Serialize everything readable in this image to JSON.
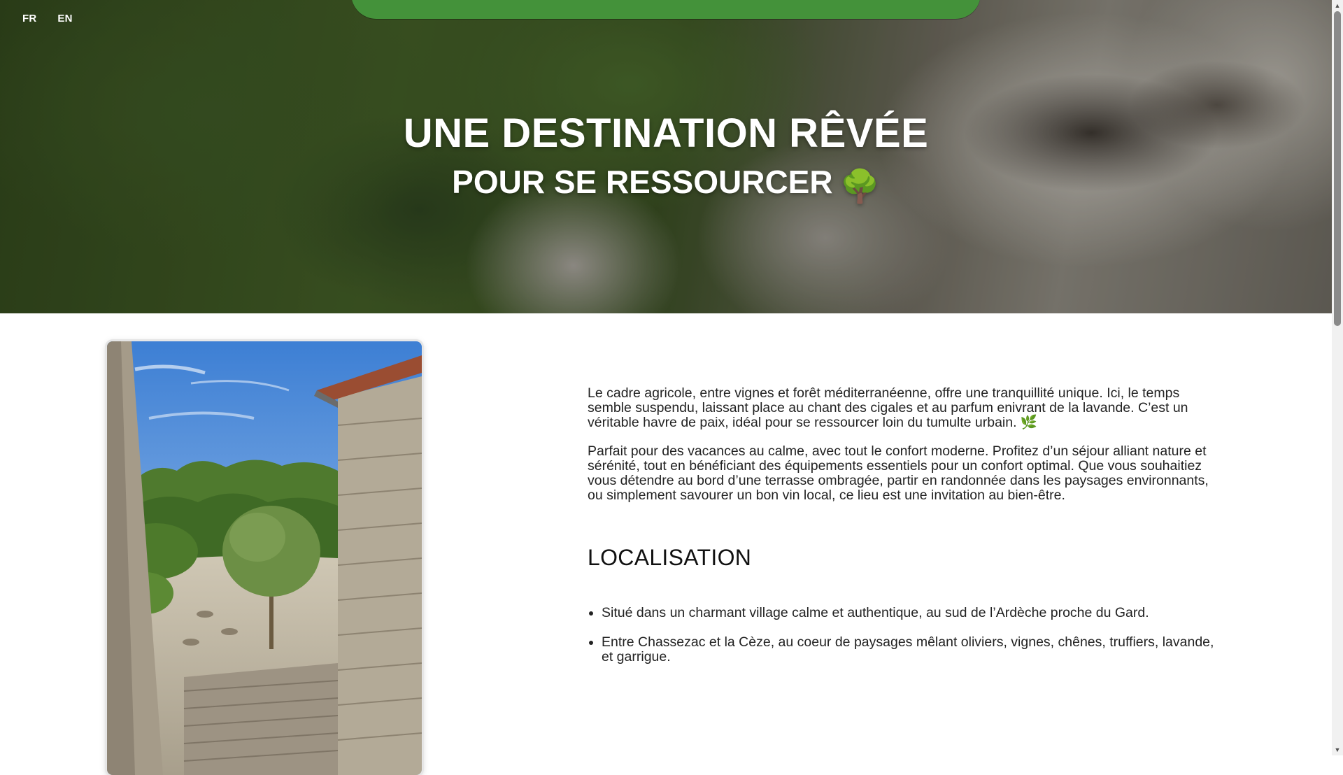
{
  "language_switcher": {
    "fr": "FR",
    "en": "EN"
  },
  "hero": {
    "title": "UNE DESTINATION RÊVÉE",
    "subtitle": "POUR SE RESSOURCER",
    "subtitle_emoji": "🌳"
  },
  "intro": {
    "paragraph1": "Le cadre agricole, entre vignes et forêt méditerranéenne, offre une tranquillité unique. Ici, le temps semble suspendu, laissant place au chant des cigales et au parfum enivrant de la lavande. C’est un véritable havre de paix, idéal pour se ressourcer loin du tumulte urbain. 🌿",
    "paragraph2": "Parfait pour des vacances au calme, avec tout le confort moderne. Profitez d’un séjour alliant nature et sérénité, tout en bénéficiant des équipements essentiels pour un confort optimal. Que vous souhaitiez vous détendre au bord d’une terrasse ombragée, partir en randonnée dans les paysages environnants, ou simplement savourer un bon vin local, ce lieu est une invitation au bien-être."
  },
  "localisation": {
    "title": "LOCALISATION",
    "items": [
      "Situé dans un charmant village calme et authentique, au sud de l’Ardèche proche du Gard.",
      "Entre Chassezac et la Cèze, au coeur de paysages mêlant oliviers, vignes, chênes, truffiers, lavande, et garrigue."
    ]
  },
  "colors": {
    "nav_green": "#44923a",
    "hero_text": "#ffffff"
  }
}
